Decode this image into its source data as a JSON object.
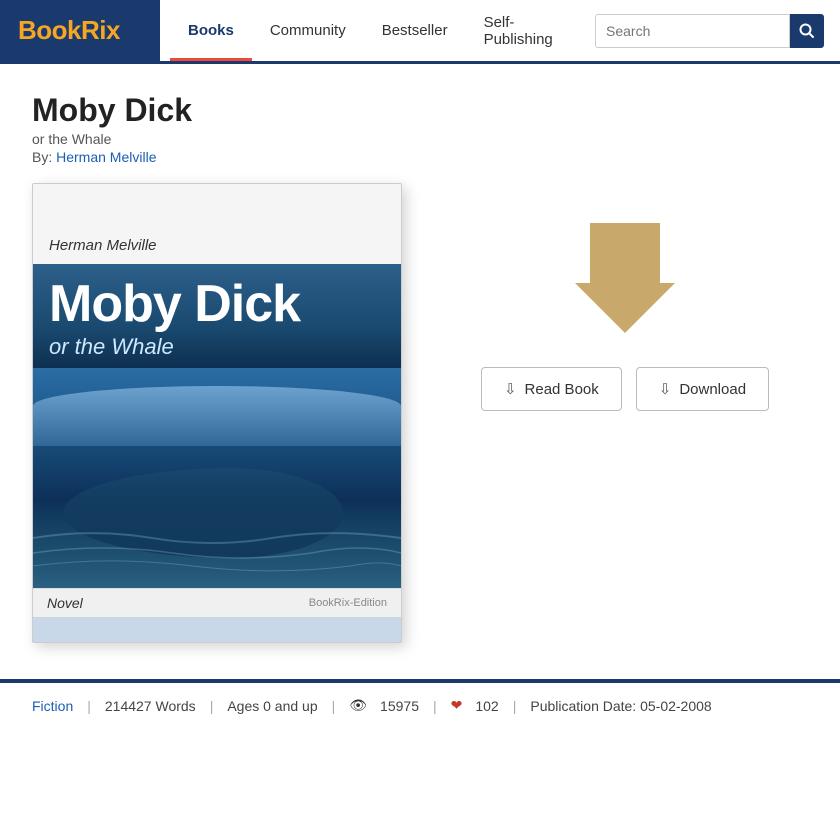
{
  "logo": {
    "text_book": "Book",
    "text_rix": "Rix"
  },
  "nav": {
    "items": [
      {
        "label": "Books",
        "active": true
      },
      {
        "label": "Community",
        "active": false
      },
      {
        "label": "Bestseller",
        "active": false
      },
      {
        "label": "Self-Publishing",
        "active": false
      }
    ]
  },
  "search": {
    "placeholder": "Search",
    "value": ""
  },
  "book": {
    "title": "Moby Dick",
    "subtitle": "or the Whale",
    "author_prefix": "By: ",
    "author_name": "Herman Melville",
    "cover": {
      "author": "Herman Melville",
      "title_line1": "Moby Dick",
      "subtitle": "or the Whale",
      "label_novel": "Novel",
      "edition": "BookRix-Edition"
    },
    "buttons": {
      "read": "Read Book",
      "download": "Download"
    },
    "meta": {
      "genre": "Fiction",
      "words": "214427 Words",
      "ages": "Ages 0 and up",
      "views": "15975",
      "likes": "102",
      "publication_label": "Publication Date: 05-02-2008"
    }
  }
}
